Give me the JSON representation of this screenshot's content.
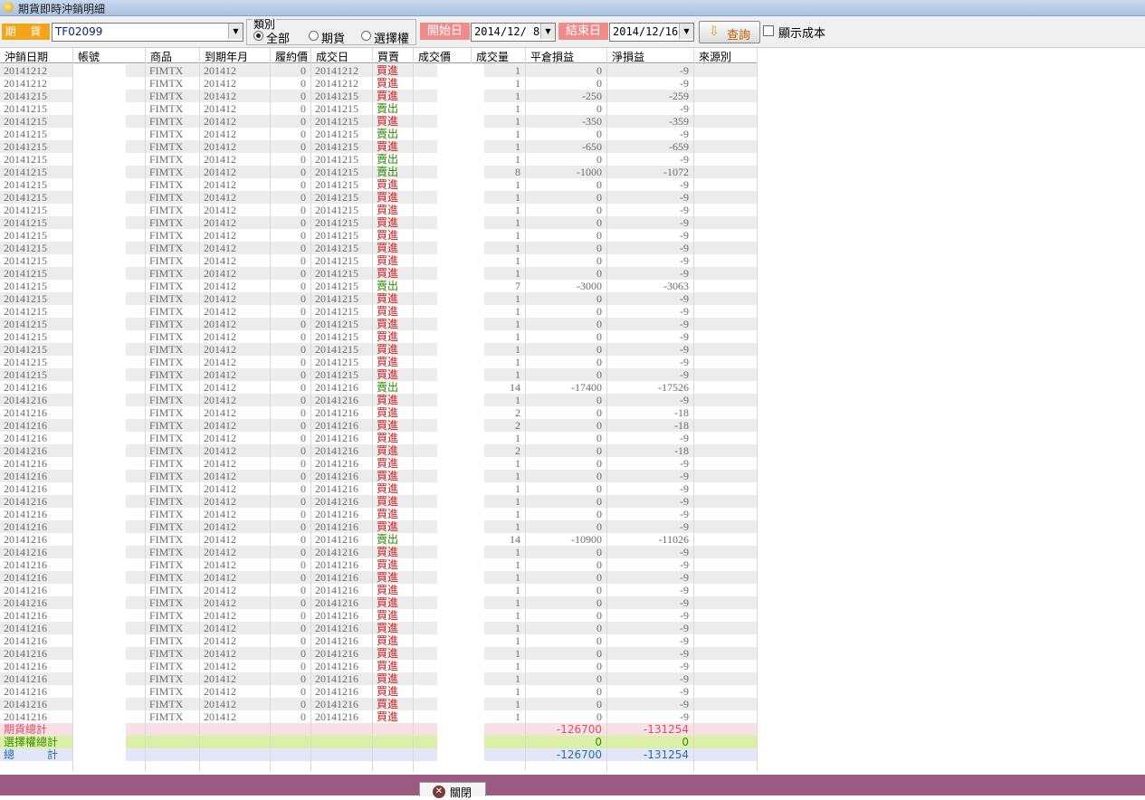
{
  "window": {
    "title": "期貨即時沖銷明細"
  },
  "toolbar": {
    "kind_label": "期 貨",
    "account_value": "TF02099",
    "category_legend": "類別",
    "radios": [
      {
        "label": "全部",
        "checked": true
      },
      {
        "label": "期貨",
        "checked": false
      },
      {
        "label": "選擇權",
        "checked": false
      }
    ],
    "start_label": "開始日",
    "start_date": "2014/12/ 8",
    "end_label": "結束日",
    "end_date": "2014/12/16",
    "query_label": "查詢",
    "show_cost_label": "顯示成本"
  },
  "table": {
    "columns": [
      "沖銷日期",
      "帳號",
      "商品",
      "到期年月",
      "履約價",
      "成交日",
      "買賣",
      "成交價",
      "成交量",
      "平倉損益",
      "淨損益",
      "來源別"
    ],
    "rows": [
      [
        "20141212",
        "",
        "FIMTX",
        "201412",
        "0",
        "20141212",
        "買進",
        "",
        "1",
        "0",
        "-9",
        ""
      ],
      [
        "20141212",
        "",
        "FIMTX",
        "201412",
        "0",
        "20141212",
        "買進",
        "",
        "1",
        "0",
        "-9",
        ""
      ],
      [
        "20141215",
        "",
        "FIMTX",
        "201412",
        "0",
        "20141215",
        "買進",
        "",
        "1",
        "-250",
        "-259",
        ""
      ],
      [
        "20141215",
        "",
        "FIMTX",
        "201412",
        "0",
        "20141215",
        "賣出",
        "",
        "1",
        "0",
        "-9",
        ""
      ],
      [
        "20141215",
        "",
        "FIMTX",
        "201412",
        "0",
        "20141215",
        "買進",
        "",
        "1",
        "-350",
        "-359",
        ""
      ],
      [
        "20141215",
        "",
        "FIMTX",
        "201412",
        "0",
        "20141215",
        "賣出",
        "",
        "1",
        "0",
        "-9",
        ""
      ],
      [
        "20141215",
        "",
        "FIMTX",
        "201412",
        "0",
        "20141215",
        "買進",
        "",
        "1",
        "-650",
        "-659",
        ""
      ],
      [
        "20141215",
        "",
        "FIMTX",
        "201412",
        "0",
        "20141215",
        "賣出",
        "",
        "1",
        "0",
        "-9",
        ""
      ],
      [
        "20141215",
        "",
        "FIMTX",
        "201412",
        "0",
        "20141215",
        "賣出",
        "",
        "8",
        "-1000",
        "-1072",
        ""
      ],
      [
        "20141215",
        "",
        "FIMTX",
        "201412",
        "0",
        "20141215",
        "買進",
        "",
        "1",
        "0",
        "-9",
        ""
      ],
      [
        "20141215",
        "",
        "FIMTX",
        "201412",
        "0",
        "20141215",
        "買進",
        "",
        "1",
        "0",
        "-9",
        ""
      ],
      [
        "20141215",
        "",
        "FIMTX",
        "201412",
        "0",
        "20141215",
        "買進",
        "",
        "1",
        "0",
        "-9",
        ""
      ],
      [
        "20141215",
        "",
        "FIMTX",
        "201412",
        "0",
        "20141215",
        "買進",
        "",
        "1",
        "0",
        "-9",
        ""
      ],
      [
        "20141215",
        "",
        "FIMTX",
        "201412",
        "0",
        "20141215",
        "買進",
        "",
        "1",
        "0",
        "-9",
        ""
      ],
      [
        "20141215",
        "",
        "FIMTX",
        "201412",
        "0",
        "20141215",
        "買進",
        "",
        "1",
        "0",
        "-9",
        ""
      ],
      [
        "20141215",
        "",
        "FIMTX",
        "201412",
        "0",
        "20141215",
        "買進",
        "",
        "1",
        "0",
        "-9",
        ""
      ],
      [
        "20141215",
        "",
        "FIMTX",
        "201412",
        "0",
        "20141215",
        "買進",
        "",
        "1",
        "0",
        "-9",
        ""
      ],
      [
        "20141215",
        "",
        "FIMTX",
        "201412",
        "0",
        "20141215",
        "賣出",
        "",
        "7",
        "-3000",
        "-3063",
        ""
      ],
      [
        "20141215",
        "",
        "FIMTX",
        "201412",
        "0",
        "20141215",
        "買進",
        "",
        "1",
        "0",
        "-9",
        ""
      ],
      [
        "20141215",
        "",
        "FIMTX",
        "201412",
        "0",
        "20141215",
        "買進",
        "",
        "1",
        "0",
        "-9",
        ""
      ],
      [
        "20141215",
        "",
        "FIMTX",
        "201412",
        "0",
        "20141215",
        "買進",
        "",
        "1",
        "0",
        "-9",
        ""
      ],
      [
        "20141215",
        "",
        "FIMTX",
        "201412",
        "0",
        "20141215",
        "買進",
        "",
        "1",
        "0",
        "-9",
        ""
      ],
      [
        "20141215",
        "",
        "FIMTX",
        "201412",
        "0",
        "20141215",
        "買進",
        "",
        "1",
        "0",
        "-9",
        ""
      ],
      [
        "20141215",
        "",
        "FIMTX",
        "201412",
        "0",
        "20141215",
        "買進",
        "",
        "1",
        "0",
        "-9",
        ""
      ],
      [
        "20141215",
        "",
        "FIMTX",
        "201412",
        "0",
        "20141215",
        "買進",
        "",
        "1",
        "0",
        "-9",
        ""
      ],
      [
        "20141216",
        "",
        "FIMTX",
        "201412",
        "0",
        "20141216",
        "賣出",
        "",
        "14",
        "-17400",
        "-17526",
        ""
      ],
      [
        "20141216",
        "",
        "FIMTX",
        "201412",
        "0",
        "20141216",
        "買進",
        "",
        "1",
        "0",
        "-9",
        ""
      ],
      [
        "20141216",
        "",
        "FIMTX",
        "201412",
        "0",
        "20141216",
        "買進",
        "",
        "2",
        "0",
        "-18",
        ""
      ],
      [
        "20141216",
        "",
        "FIMTX",
        "201412",
        "0",
        "20141216",
        "買進",
        "",
        "2",
        "0",
        "-18",
        ""
      ],
      [
        "20141216",
        "",
        "FIMTX",
        "201412",
        "0",
        "20141216",
        "買進",
        "",
        "1",
        "0",
        "-9",
        ""
      ],
      [
        "20141216",
        "",
        "FIMTX",
        "201412",
        "0",
        "20141216",
        "買進",
        "",
        "2",
        "0",
        "-18",
        ""
      ],
      [
        "20141216",
        "",
        "FIMTX",
        "201412",
        "0",
        "20141216",
        "買進",
        "",
        "1",
        "0",
        "-9",
        ""
      ],
      [
        "20141216",
        "",
        "FIMTX",
        "201412",
        "0",
        "20141216",
        "買進",
        "",
        "1",
        "0",
        "-9",
        ""
      ],
      [
        "20141216",
        "",
        "FIMTX",
        "201412",
        "0",
        "20141216",
        "買進",
        "",
        "1",
        "0",
        "-9",
        ""
      ],
      [
        "20141216",
        "",
        "FIMTX",
        "201412",
        "0",
        "20141216",
        "買進",
        "",
        "1",
        "0",
        "-9",
        ""
      ],
      [
        "20141216",
        "",
        "FIMTX",
        "201412",
        "0",
        "20141216",
        "買進",
        "",
        "1",
        "0",
        "-9",
        ""
      ],
      [
        "20141216",
        "",
        "FIMTX",
        "201412",
        "0",
        "20141216",
        "買進",
        "",
        "1",
        "0",
        "-9",
        ""
      ],
      [
        "20141216",
        "",
        "FIMTX",
        "201412",
        "0",
        "20141216",
        "賣出",
        "",
        "14",
        "-10900",
        "-11026",
        ""
      ],
      [
        "20141216",
        "",
        "FIMTX",
        "201412",
        "0",
        "20141216",
        "買進",
        "",
        "1",
        "0",
        "-9",
        ""
      ],
      [
        "20141216",
        "",
        "FIMTX",
        "201412",
        "0",
        "20141216",
        "買進",
        "",
        "1",
        "0",
        "-9",
        ""
      ],
      [
        "20141216",
        "",
        "FIMTX",
        "201412",
        "0",
        "20141216",
        "買進",
        "",
        "1",
        "0",
        "-9",
        ""
      ],
      [
        "20141216",
        "",
        "FIMTX",
        "201412",
        "0",
        "20141216",
        "買進",
        "",
        "1",
        "0",
        "-9",
        ""
      ],
      [
        "20141216",
        "",
        "FIMTX",
        "201412",
        "0",
        "20141216",
        "買進",
        "",
        "1",
        "0",
        "-9",
        ""
      ],
      [
        "20141216",
        "",
        "FIMTX",
        "201412",
        "0",
        "20141216",
        "買進",
        "",
        "1",
        "0",
        "-9",
        ""
      ],
      [
        "20141216",
        "",
        "FIMTX",
        "201412",
        "0",
        "20141216",
        "買進",
        "",
        "1",
        "0",
        "-9",
        ""
      ],
      [
        "20141216",
        "",
        "FIMTX",
        "201412",
        "0",
        "20141216",
        "買進",
        "",
        "1",
        "0",
        "-9",
        ""
      ],
      [
        "20141216",
        "",
        "FIMTX",
        "201412",
        "0",
        "20141216",
        "買進",
        "",
        "1",
        "0",
        "-9",
        ""
      ],
      [
        "20141216",
        "",
        "FIMTX",
        "201412",
        "0",
        "20141216",
        "買進",
        "",
        "1",
        "0",
        "-9",
        ""
      ],
      [
        "20141216",
        "",
        "FIMTX",
        "201412",
        "0",
        "20141216",
        "買進",
        "",
        "1",
        "0",
        "-9",
        ""
      ],
      [
        "20141216",
        "",
        "FIMTX",
        "201412",
        "0",
        "20141216",
        "買進",
        "",
        "1",
        "0",
        "-9",
        ""
      ],
      [
        "20141216",
        "",
        "FIMTX",
        "201412",
        "0",
        "20141216",
        "買進",
        "",
        "1",
        "0",
        "-9",
        ""
      ],
      [
        "20141216",
        "",
        "FIMTX",
        "201412",
        "0",
        "20141216",
        "買進",
        "",
        "1",
        "0",
        "-9",
        ""
      ]
    ],
    "totals": [
      {
        "label": "期貨總計",
        "close_pnl": "-126700",
        "net_pnl": "-131254",
        "bg": "#f8e1e6",
        "color": "#d94f6a"
      },
      {
        "label": "選擇權總計",
        "close_pnl": "0",
        "net_pnl": "0",
        "bg": "#d9f0a6",
        "color": "#3c8f00"
      },
      {
        "label": "總　　　計",
        "close_pnl": "-126700",
        "net_pnl": "-131254",
        "bg": "#e3e6f8",
        "color": "#1f6fb0"
      }
    ]
  },
  "footer": {
    "close_label": "關閉"
  },
  "colors": {
    "buy": "#d21c1c",
    "sell": "#2a8a00",
    "footer": "#9c5a80",
    "kind_label": "#f2a51a",
    "date_label": "#ef8b8b"
  }
}
